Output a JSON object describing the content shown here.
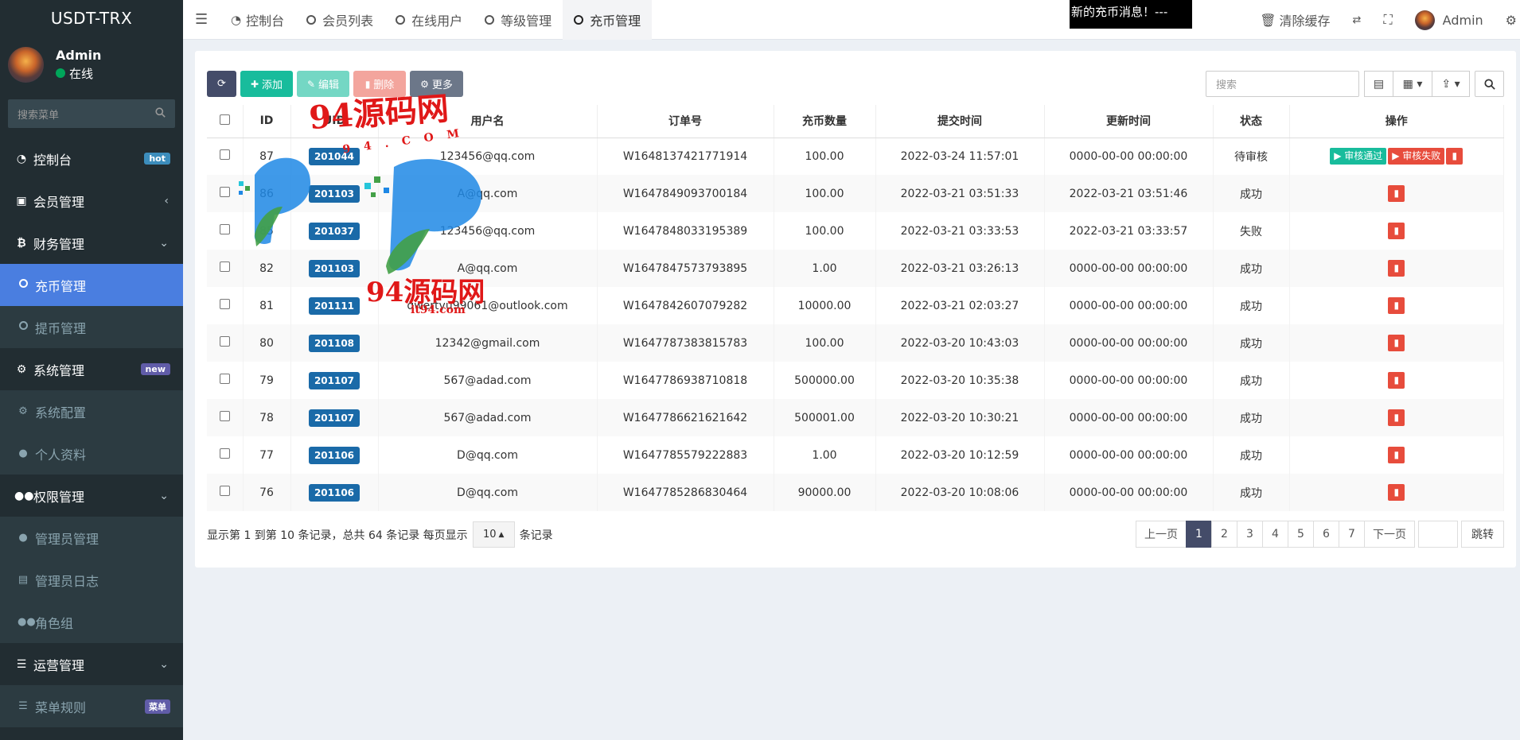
{
  "brand": "USDT-TRX",
  "user": {
    "name": "Admin",
    "status": "在线"
  },
  "sidebar": {
    "search_placeholder": "搜索菜单",
    "items": [
      {
        "label": "控制台",
        "icon": "dashboard-icon",
        "badge": "hot",
        "badge_color": "#3c8dbc"
      },
      {
        "label": "会员管理",
        "icon": "id-card-icon"
      },
      {
        "label": "财务管理",
        "icon": "bitcoin-icon"
      },
      {
        "label": "充币管理",
        "icon": "circle-icon",
        "active": true
      },
      {
        "label": "提币管理",
        "icon": "circle-icon"
      },
      {
        "label": "系统管理",
        "icon": "cogs-icon",
        "badge": "new",
        "badge_color": "#605ca8"
      },
      {
        "label": "系统配置",
        "icon": "gear-icon"
      },
      {
        "label": "个人资料",
        "icon": "user-icon"
      },
      {
        "label": "权限管理",
        "icon": "group-icon"
      },
      {
        "label": "管理员管理",
        "icon": "user-icon"
      },
      {
        "label": "管理员日志",
        "icon": "list-alt-icon"
      },
      {
        "label": "角色组",
        "icon": "group-icon"
      },
      {
        "label": "运营管理",
        "icon": "list-icon"
      },
      {
        "label": "菜单规则",
        "icon": "bars-icon",
        "badge": "菜单",
        "badge_color": "#605ca8"
      }
    ]
  },
  "topbar": {
    "tabs": [
      {
        "label": "控制台"
      },
      {
        "label": "会员列表"
      },
      {
        "label": "在线用户"
      },
      {
        "label": "等级管理"
      },
      {
        "label": "充币管理",
        "active": true
      }
    ],
    "marquee": "新的充币消息！---",
    "clear_cache": "清除缓存",
    "admin": "Admin"
  },
  "toolbar": {
    "add": "添加",
    "edit": "编辑",
    "delete": "删除",
    "more": "更多",
    "search_placeholder": "搜索"
  },
  "table": {
    "headers": [
      "ID",
      "UID",
      "用户名",
      "订单号",
      "充币数量",
      "提交时间",
      "更新时间",
      "状态",
      "操作"
    ],
    "rows": [
      {
        "id": "87",
        "uid": "201044",
        "username": "123456@qq.com",
        "order": "W1648137421771914",
        "amount": "100.00",
        "submitted": "2022-03-24 11:57:01",
        "updated": "0000-00-00 00:00:00",
        "status": "待审核",
        "status_type": "wait"
      },
      {
        "id": "86",
        "uid": "201103",
        "username": "A@qq.com",
        "order": "W1647849093700184",
        "amount": "100.00",
        "submitted": "2022-03-21 03:51:33",
        "updated": "2022-03-21 03:51:46",
        "status": "成功",
        "status_type": "ok"
      },
      {
        "id": "85",
        "uid": "201037",
        "username": "123456@qq.com",
        "order": "W1647848033195389",
        "amount": "100.00",
        "submitted": "2022-03-21 03:33:53",
        "updated": "2022-03-21 03:33:57",
        "status": "失败",
        "status_type": "fail"
      },
      {
        "id": "82",
        "uid": "201103",
        "username": "A@qq.com",
        "order": "W1647847573793895",
        "amount": "1.00",
        "submitted": "2022-03-21 03:26:13",
        "updated": "0000-00-00 00:00:00",
        "status": "成功",
        "status_type": "ok"
      },
      {
        "id": "81",
        "uid": "201111",
        "username": "qwertyu99061@outlook.com",
        "order": "W1647842607079282",
        "amount": "10000.00",
        "submitted": "2022-03-21 02:03:27",
        "updated": "0000-00-00 00:00:00",
        "status": "成功",
        "status_type": "ok"
      },
      {
        "id": "80",
        "uid": "201108",
        "username": "12342@gmail.com",
        "order": "W1647787383815783",
        "amount": "100.00",
        "submitted": "2022-03-20 10:43:03",
        "updated": "0000-00-00 00:00:00",
        "status": "成功",
        "status_type": "ok"
      },
      {
        "id": "79",
        "uid": "201107",
        "username": "567@adad.com",
        "order": "W1647786938710818",
        "amount": "500000.00",
        "submitted": "2022-03-20 10:35:38",
        "updated": "0000-00-00 00:00:00",
        "status": "成功",
        "status_type": "ok"
      },
      {
        "id": "78",
        "uid": "201107",
        "username": "567@adad.com",
        "order": "W1647786621621642",
        "amount": "500001.00",
        "submitted": "2022-03-20 10:30:21",
        "updated": "0000-00-00 00:00:00",
        "status": "成功",
        "status_type": "ok"
      },
      {
        "id": "77",
        "uid": "201106",
        "username": "D@qq.com",
        "order": "W1647785579222883",
        "amount": "1.00",
        "submitted": "2022-03-20 10:12:59",
        "updated": "0000-00-00 00:00:00",
        "status": "成功",
        "status_type": "ok"
      },
      {
        "id": "76",
        "uid": "201106",
        "username": "D@qq.com",
        "order": "W1647785286830464",
        "amount": "90000.00",
        "submitted": "2022-03-20 10:08:06",
        "updated": "0000-00-00 00:00:00",
        "status": "成功",
        "status_type": "ok"
      }
    ],
    "approve_label": "审核通过",
    "reject_label": "审核失败"
  },
  "footer": {
    "info": "显示第 1 到第 10 条记录，总共 64 条记录 每页显示",
    "page_size": "10",
    "suffix": "条记录",
    "prev": "上一页",
    "pages": [
      "1",
      "2",
      "3",
      "4",
      "5",
      "6",
      "7"
    ],
    "current_page": "1",
    "next": "下一页",
    "go": "跳转"
  },
  "watermark": {
    "text": "94源码网",
    "sub": "it94.com",
    "letters": "9 4 . C O M"
  },
  "colors": {
    "sidebar_bg": "#222d32",
    "active_blue": "#4a7ee0",
    "success": "#18bc9c",
    "danger": "#e74c3c",
    "primary_dark": "#444c69"
  }
}
